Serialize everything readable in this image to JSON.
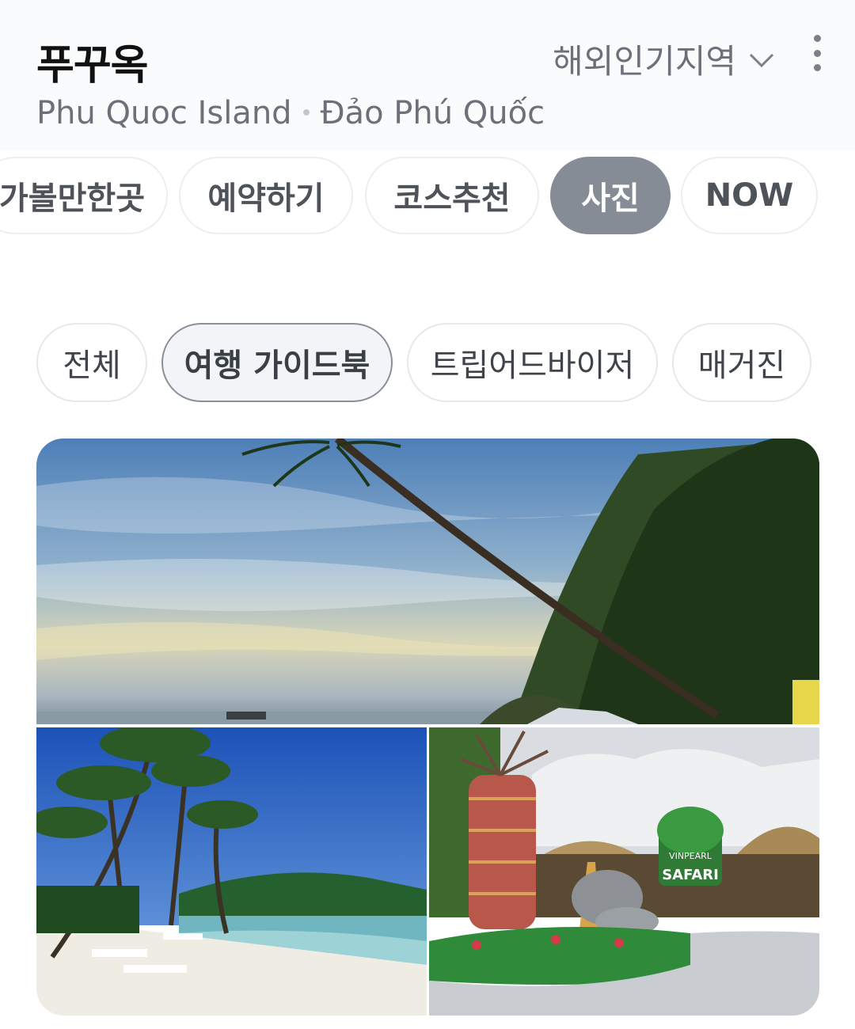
{
  "header": {
    "title": "푸꾸옥",
    "region_label": "해외인기지역",
    "subtitle_en": "Phu Quoc Island",
    "subtitle_vi": "Đảo Phú Quốc"
  },
  "tabs": [
    {
      "label": "가볼만한곳",
      "active": false
    },
    {
      "label": "예약하기",
      "active": false
    },
    {
      "label": "코스추천",
      "active": false
    },
    {
      "label": "사진",
      "active": true
    },
    {
      "label": "NOW",
      "active": false
    }
  ],
  "filters": [
    {
      "label": "전체",
      "active": false
    },
    {
      "label": "여행 가이드북",
      "active": true
    },
    {
      "label": "트립어드바이저",
      "active": false
    },
    {
      "label": "매거진",
      "active": false
    }
  ],
  "photos": {
    "photo3_sign_line1": "VINPEARL",
    "photo3_sign_line2": "SAFARI"
  },
  "colors": {
    "active_tab": "#858c96",
    "text_muted": "#6b7079"
  }
}
